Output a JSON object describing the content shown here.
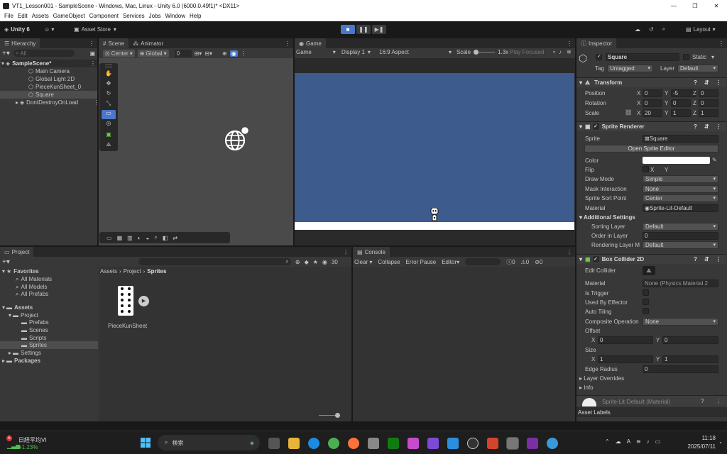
{
  "window": {
    "title": "VT1_Lesson001 - SampleScene - Windows, Mac, Linux - Unity 6.0 (6000.0.49f1)* <DX11>"
  },
  "menu": [
    "File",
    "Edit",
    "Assets",
    "GameObject",
    "Component",
    "Services",
    "Jobs",
    "Window",
    "Help"
  ],
  "toolbar": {
    "account": "Unity 6",
    "asset_store": "Asset Store",
    "layout": "Layout"
  },
  "hierarchy": {
    "tab": "Hierarchy",
    "search_placeholder": "All",
    "items": [
      {
        "label": "SampleScene*"
      },
      {
        "label": "Main Camera"
      },
      {
        "label": "Global Light 2D"
      },
      {
        "label": "PieceKunSheet_0"
      },
      {
        "label": "Square"
      },
      {
        "label": "DontDestroyOnLoad"
      }
    ]
  },
  "scene": {
    "tabs": [
      "Scene",
      "Animator"
    ],
    "pivot": "Center",
    "space": "Global",
    "snap": "0"
  },
  "game": {
    "tab": "Game",
    "mode": "Game",
    "display": "Display 1",
    "aspect": "16:9 Aspect",
    "scale_label": "Scale",
    "scale_value": "1.3x",
    "play_focused": "Play Focused",
    "bg_color": "#3d5b8c",
    "ground_color": "#ffffff"
  },
  "project": {
    "tab": "Project",
    "count": "30",
    "tree": [
      {
        "label": "Favorites"
      },
      {
        "label": "All Materials"
      },
      {
        "label": "All Models"
      },
      {
        "label": "All Prefabs"
      },
      {
        "label": "Assets"
      },
      {
        "label": "Project"
      },
      {
        "label": "Prefabs"
      },
      {
        "label": "Scenes"
      },
      {
        "label": "Scripts"
      },
      {
        "label": "Sprites"
      },
      {
        "label": "Settings"
      },
      {
        "label": "Packages"
      }
    ],
    "breadcrumb": [
      "Assets",
      "Project",
      "Sprites"
    ],
    "asset": "PieceKunSheet"
  },
  "console": {
    "tab": "Console",
    "clear": "Clear",
    "collapse": "Collapse",
    "error_pause": "Error Pause",
    "editor": "Editor",
    "counts": [
      "0",
      "0",
      "0"
    ]
  },
  "inspector": {
    "tab": "Inspector",
    "name": "Square",
    "static": "Static",
    "tag_label": "Tag",
    "tag": "Untagged",
    "layer_label": "Layer",
    "layer": "Default",
    "transform": {
      "title": "Transform",
      "position": {
        "label": "Position",
        "x": "0",
        "y": "-5",
        "z": "0"
      },
      "rotation": {
        "label": "Rotation",
        "x": "0",
        "y": "0",
        "z": "0"
      },
      "scale": {
        "label": "Scale",
        "x": "20",
        "y": "1",
        "z": "1"
      }
    },
    "sprite_renderer": {
      "title": "Sprite Renderer",
      "sprite_label": "Sprite",
      "sprite": "Square",
      "open_editor": "Open Sprite Editor",
      "color_label": "Color",
      "flip_label": "Flip",
      "flip_x": "X",
      "flip_y": "Y",
      "draw_mode_label": "Draw Mode",
      "draw_mode": "Simple",
      "mask_label": "Mask Interaction",
      "mask": "None",
      "sort_point_label": "Sprite Sort Point",
      "sort_point": "Center",
      "material_label": "Material",
      "material": "Sprite-Lit-Default",
      "additional": "Additional Settings",
      "sorting_layer_label": "Sorting Layer",
      "sorting_layer": "Default",
      "order_label": "Order in Layer",
      "order": "0",
      "rendering_layer_label": "Rendering Layer M",
      "rendering_layer": "Default"
    },
    "box_collider": {
      "title": "Box Collider 2D",
      "edit_collider": "Edit Collider",
      "material_label": "Material",
      "material": "None (Physics Material 2",
      "is_trigger": "Is Trigger",
      "used_by_effector": "Used By Effector",
      "auto_tiling": "Auto Tiling",
      "composite_label": "Composite Operation",
      "composite": "None",
      "offset_label": "Offset",
      "offset_x": "0",
      "offset_y": "0",
      "size_label": "Size",
      "size_x": "1",
      "size_y": "1",
      "edge_radius_label": "Edge Radius",
      "edge_radius": "0",
      "layer_overrides": "Layer Overrides",
      "info": "Info"
    },
    "material_preview": "Sprite-Lit-Default (Material)",
    "asset_labels": "Asset Labels"
  },
  "taskbar": {
    "stock_name": "日経平均VI",
    "stock_change": "+1.23%",
    "stock_badge": "5",
    "search_placeholder": "検索",
    "time": "11:18",
    "date": "2025/07/11",
    "ime": "A"
  }
}
